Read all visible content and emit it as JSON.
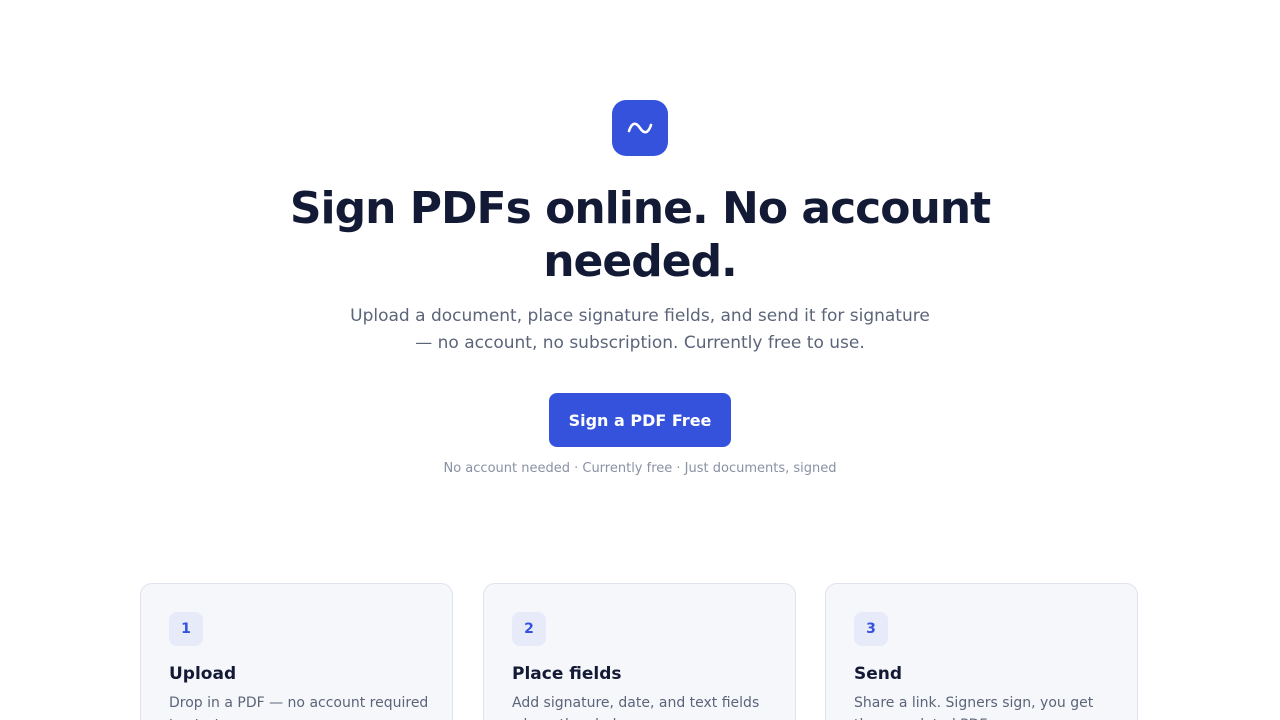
{
  "hero": {
    "logo_icon": "signature-squiggle-icon",
    "headline": "Sign PDFs online. No account needed.",
    "subheadline": "Upload a document, place signature fields, and send it for signature — no account, no subscription. Currently free to use.",
    "cta_label": "Sign a PDF Free",
    "tagline": "No account needed · Currently free · Just documents, signed"
  },
  "steps": [
    {
      "number": "1",
      "title": "Upload",
      "description": "Drop in a PDF — no account required to start."
    },
    {
      "number": "2",
      "title": "Place fields",
      "description": "Add signature, date, and text fields where they belong."
    },
    {
      "number": "3",
      "title": "Send",
      "description": "Share a link. Signers sign, you get the completed PDF."
    }
  ],
  "colors": {
    "accent": "#3452db",
    "heading": "#131a35",
    "body_text": "#5b6479",
    "muted_text": "#8a91a3",
    "card_bg": "#f6f7fb",
    "card_border": "#dfe3ee",
    "badge_bg": "#e6eaf9"
  }
}
